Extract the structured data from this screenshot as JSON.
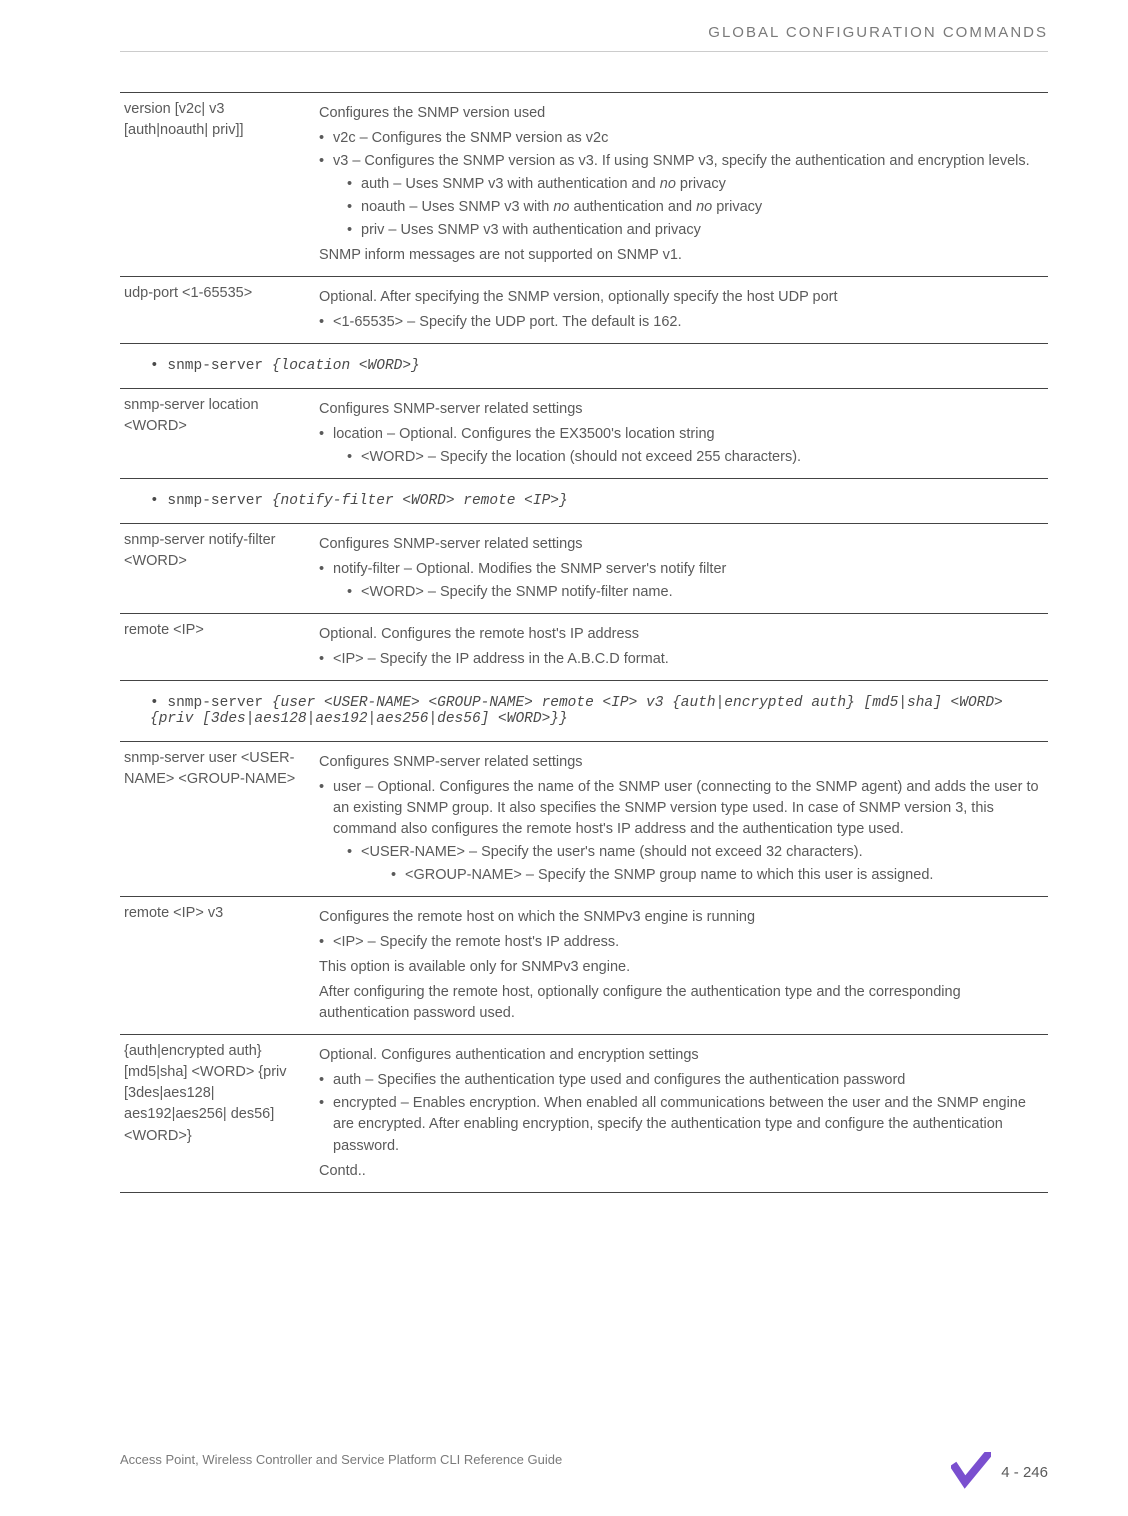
{
  "header": "GLOBAL CONFIGURATION COMMANDS",
  "table1": {
    "r1": {
      "param": "version [v2c| v3 [auth|noauth| priv]]",
      "lead": "Configures the SNMP version used",
      "b1": "v2c – Configures the SNMP version as v2c",
      "b2": "v3 – Configures the SNMP version as v3. If using SNMP v3, specify the authentication and encryption levels.",
      "b2a": "auth – Uses SNMP v3 with authentication and ",
      "b2a_em": "no",
      "b2a_tail": " privacy",
      "b2b_pre": "noauth – Uses SNMP v3 with ",
      "b2b_em1": "no",
      "b2b_mid": " authentication and ",
      "b2b_em2": "no",
      "b2b_tail": " privacy",
      "b2c": "priv – Uses SNMP v3 with authentication and privacy",
      "trail": "SNMP inform messages are not supported on SNMP v1."
    },
    "r2": {
      "param": "udp-port <1-65535>",
      "lead": "Optional. After specifying the SNMP version, optionally specify the host UDP port",
      "b1": "<1-65535> – Specify the UDP port. The default is 162."
    }
  },
  "code1": {
    "cmd": "snmp-server",
    "args": "{location <WORD>}"
  },
  "table2": {
    "r1": {
      "param": "snmp-server location <WORD>",
      "lead": "Configures SNMP-server related settings",
      "b1": "location – Optional. Configures the EX3500's location string",
      "b1a": "<WORD> – Specify the location (should not exceed 255 characters)."
    }
  },
  "code2": {
    "cmd": "snmp-server",
    "args": "{notify-filter <WORD> remote <IP>}"
  },
  "table3": {
    "r1": {
      "param": "snmp-server notify-filter <WORD>",
      "lead": "Configures SNMP-server related settings",
      "b1": "notify-filter – Optional. Modifies the SNMP server's notify filter",
      "b1a": "<WORD> – Specify the SNMP notify-filter name."
    },
    "r2": {
      "param": "remote <IP>",
      "lead": "Optional. Configures the remote host's IP address",
      "b1": "<IP> – Specify the IP address in the A.B.C.D format."
    }
  },
  "code3": {
    "cmd": "snmp-server",
    "args": "{user <USER-NAME> <GROUP-NAME> remote <IP> v3 {auth|encrypted auth} [md5|sha] <WORD> {priv [3des|aes128|aes192|aes256|des56] <WORD>}}"
  },
  "table4": {
    "r1": {
      "param": "snmp-server user <USER-NAME> <GROUP-NAME>",
      "lead": "Configures SNMP-server related settings",
      "b1": "user – Optional. Configures the name of the SNMP user (connecting to the SNMP agent) and adds the user to an existing SNMP group. It also specifies the SNMP version type used. In case of SNMP version 3, this command also configures the remote host's IP address and the authentication type used.",
      "b1a": "<USER-NAME> – Specify the user's name (should not exceed 32 characters).",
      "b1a1": "<GROUP-NAME> – Specify the SNMP group name to which this user is assigned."
    },
    "r2": {
      "param": "remote <IP> v3",
      "lead": "Configures the remote host on which the SNMPv3 engine is running",
      "b1": "<IP> – Specify the remote host's IP address.",
      "mid": "This option is available only for SNMPv3 engine.",
      "trail": "After configuring the remote host, optionally configure the authentication type and the corresponding authentication password used."
    },
    "r3": {
      "param": "{auth|encrypted auth} [md5|sha] <WORD> {priv [3des|aes128| aes192|aes256| des56] <WORD>}",
      "lead": "Optional. Configures authentication and encryption settings",
      "b1": "auth – Specifies the authentication type used and configures the authentication password",
      "b2": "encrypted – Enables encryption. When enabled all communications between the user and the SNMP engine are encrypted. After enabling encryption, specify the authentication type and configure the authentication password.",
      "trail": "Contd.."
    }
  },
  "footer": {
    "text": "Access Point, Wireless Controller and Service Platform CLI Reference Guide",
    "pagenum": "4 - 246"
  }
}
